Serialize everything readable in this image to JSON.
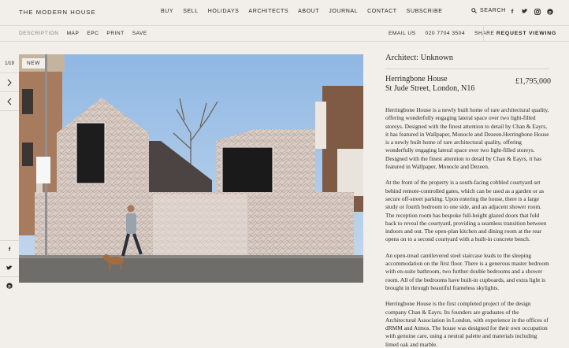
{
  "header": {
    "logo": "THE MODERN HOUSE",
    "nav": [
      "BUY",
      "SELL",
      "HOLIDAYS",
      "ARCHITECTS",
      "ABOUT",
      "JOURNAL",
      "CONTACT",
      "SUBSCRIBE"
    ],
    "search_label": "SEARCH",
    "social": [
      "facebook-icon",
      "twitter-icon",
      "instagram-icon",
      "pinterest-icon"
    ]
  },
  "subnav": {
    "left": [
      "DESCRIPTION",
      "MAP",
      "EPC",
      "PRINT",
      "SAVE"
    ],
    "email": "EMAIL US",
    "phone": "020 7704 3504",
    "share": "SHARE",
    "request": "REQUEST VIEWING"
  },
  "gallery": {
    "counter": "1/19",
    "badge": "NEW",
    "share_icons": [
      "facebook-icon",
      "twitter-icon",
      "pinterest-icon"
    ]
  },
  "listing": {
    "architect": "Architect: Unknown",
    "name": "Herringbone House",
    "address": "St Jude Street, London, N16",
    "price": "£1,795,000",
    "paragraphs": [
      "Herringbone House is a newly built home of rare architectural quality, offering wonderfully engaging lateral space over two light-filled storeys. Designed with the finest attention to detail by Chan & Eayrs, it has featured in Wallpaper, Monocle and Dezeen.Herringbone House is a newly built home of rare architectural quality, offering wonderfully engaging lateral space over two light-filled storeys. Designed with the finest attention to detail by Chan & Eayrs, it has featured in Wallpaper, Monocle and Dezeen.",
      "At the front of the property is a south-facing cobbled courtyard set behind remote-controlled gates, which can be used as a garden or as secure off-street parking. Upon entering the house, there is a large study or fourth bedroom to one side, and an adjacent shower room. The reception room has bespoke full-height glazed doors that fold back to reveal the courtyard, providing a seamless transition between indoors and out. The open-plan kitchen and dining room at the rear opens on to a second courtyard with a built-in concrete bench.",
      "An open-tread cantilevered steel staircase leads to the sleeping accommodation on the first floor. There is a generous master bedroom with en-suite bathroom, two further double bedrooms and a shower room. All of the bedrooms have built-in cupboards, and extra light is brought in through beautiful frameless skylights.",
      "Herringbone House is the first completed project of the design company Chan & Eayrs. Its founders are graduates of the Architectural Association in London, with experience in the offices of dRMM and Atmos. The house was designed for their own occupation with genuine care, using a neutral palette and materials including limed oak and marble."
    ]
  }
}
